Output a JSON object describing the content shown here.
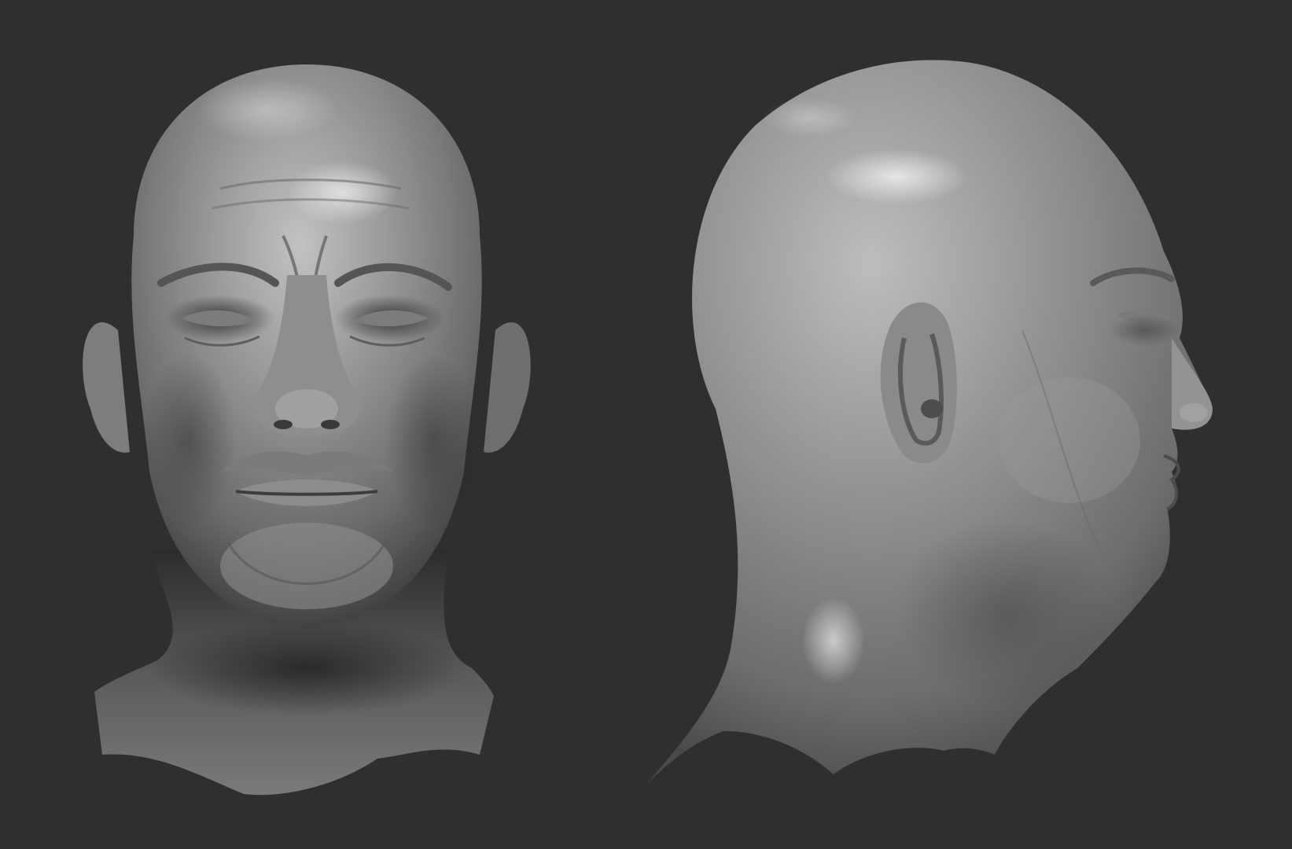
{
  "scene": {
    "background_color": "#2f2f2f",
    "clay_color": "#8a8a8a",
    "views": [
      {
        "name": "front-view",
        "subject": "sculpted-head-front"
      },
      {
        "name": "side-view",
        "subject": "sculpted-head-profile"
      }
    ]
  }
}
